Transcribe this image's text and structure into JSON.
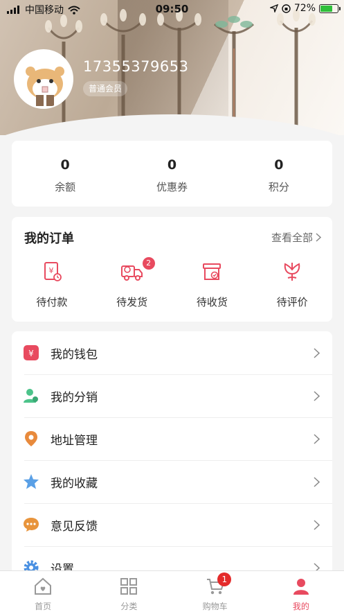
{
  "status_bar": {
    "carrier": "中国移动",
    "time": "09:50",
    "battery": "72%"
  },
  "profile": {
    "phone": "17355379653",
    "member_level": "普通会员"
  },
  "stats": [
    {
      "value": "0",
      "label": "余额"
    },
    {
      "value": "0",
      "label": "优惠券"
    },
    {
      "value": "0",
      "label": "积分"
    }
  ],
  "orders": {
    "title": "我的订单",
    "view_all": "查看全部",
    "items": [
      {
        "label": "待付款",
        "icon": "payment-icon",
        "badge": ""
      },
      {
        "label": "待发货",
        "icon": "delivery-truck-icon",
        "badge": "2"
      },
      {
        "label": "待收货",
        "icon": "receive-box-icon",
        "badge": ""
      },
      {
        "label": "待评价",
        "icon": "review-flower-icon",
        "badge": ""
      }
    ]
  },
  "menu": [
    {
      "label": "我的钱包",
      "icon": "wallet-icon",
      "color": "#e84a5f"
    },
    {
      "label": "我的分销",
      "icon": "users-icon",
      "color": "#4cc38a"
    },
    {
      "label": "地址管理",
      "icon": "location-pin-icon",
      "color": "#e88a3c"
    },
    {
      "label": "我的收藏",
      "icon": "star-icon",
      "color": "#5aa0e6"
    },
    {
      "label": "意见反馈",
      "icon": "chat-bubble-icon",
      "color": "#e8943c"
    },
    {
      "label": "设置",
      "icon": "gear-icon",
      "color": "#4a90e2"
    }
  ],
  "tabbar": {
    "active_color": "#e84a5f",
    "items": [
      {
        "label": "首页",
        "icon": "home-icon"
      },
      {
        "label": "分类",
        "icon": "category-grid-icon"
      },
      {
        "label": "购物车",
        "icon": "cart-icon",
        "badge": "1"
      },
      {
        "label": "我的",
        "icon": "profile-icon"
      }
    ]
  }
}
